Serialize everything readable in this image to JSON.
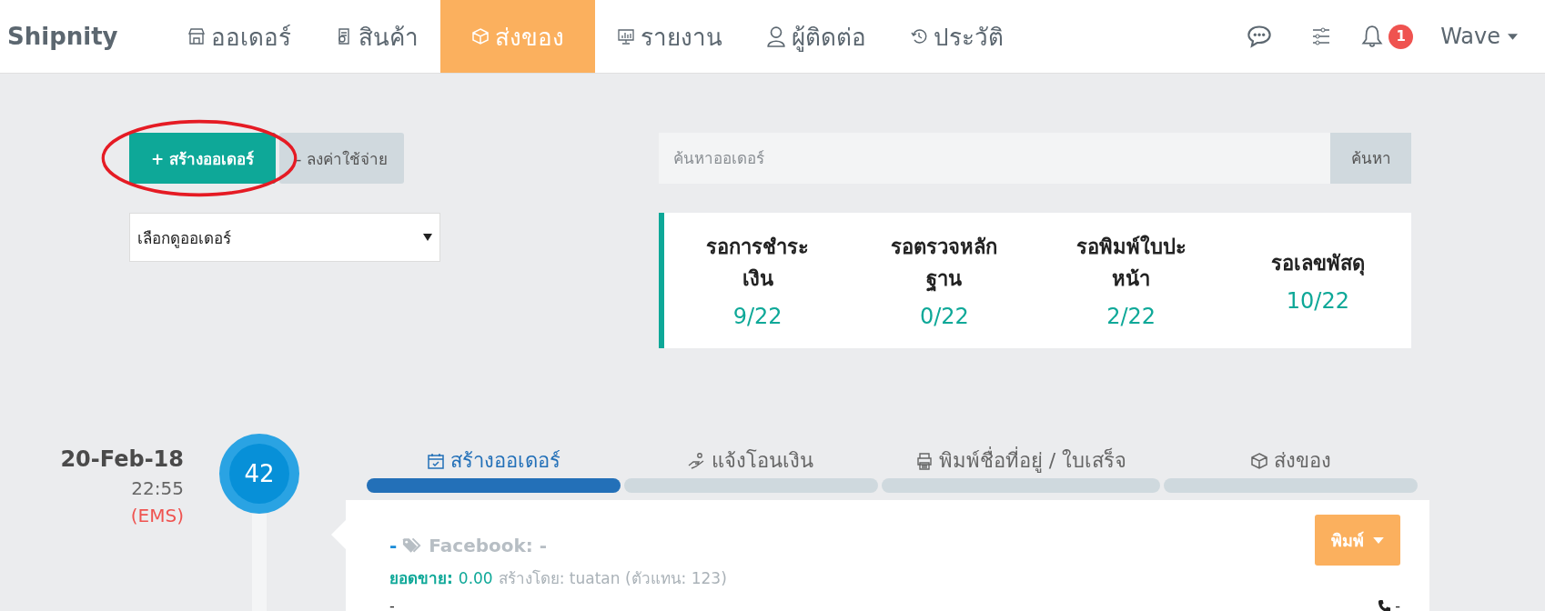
{
  "nav": {
    "logo": "Shipnity",
    "items": [
      {
        "label": "ออเดอร์",
        "selected": false
      },
      {
        "label": "สินค้า",
        "selected": false
      },
      {
        "label": "ส่งของ",
        "selected": true
      },
      {
        "label": "รายงาน",
        "selected": false
      },
      {
        "label": "ผู้ติดต่อ",
        "selected": false
      },
      {
        "label": "ประวัติ",
        "selected": false
      }
    ],
    "notification_count": "1",
    "user": "Wave"
  },
  "toolbar": {
    "create_button": "+ สร้างออเดอร์",
    "expense_button": "- ลงค่าใช้จ่าย",
    "order_filter": "เลือกดูออเดอร์",
    "search": {
      "placeholder": "ค้นหาออเดอร์",
      "button": "ค้นหา"
    }
  },
  "stats": [
    {
      "label": "รอการชำระเงิน",
      "value": "9/22"
    },
    {
      "label": "รอตรวจหลักฐาน",
      "value": "0/22"
    },
    {
      "label": "รอพิมพ์ใบปะหน้า",
      "value": "2/22"
    },
    {
      "label": "รอเลขพัสดุ",
      "value": "10/22"
    }
  ],
  "order": {
    "date": "20-Feb-18",
    "time": "22:55",
    "carrier": "(EMS)",
    "number": "42",
    "steps": [
      {
        "label": "สร้างออเดอร์",
        "selected": true
      },
      {
        "label": "แจ้งโอนเงิน",
        "selected": false
      },
      {
        "label": "พิมพ์ชื่อที่อยู่ / ใบเสร็จ",
        "selected": false
      },
      {
        "label": "ส่งของ",
        "selected": false
      }
    ],
    "customer": "-",
    "channel": "Facebook: -",
    "sales_label": "ยอดขาย:",
    "sales_value": "0.00",
    "created_by": "สร้างโดย: tuatan (ตัวแทน: 123)",
    "address": "-",
    "phone": "-",
    "print_button": "พิมพ์"
  }
}
